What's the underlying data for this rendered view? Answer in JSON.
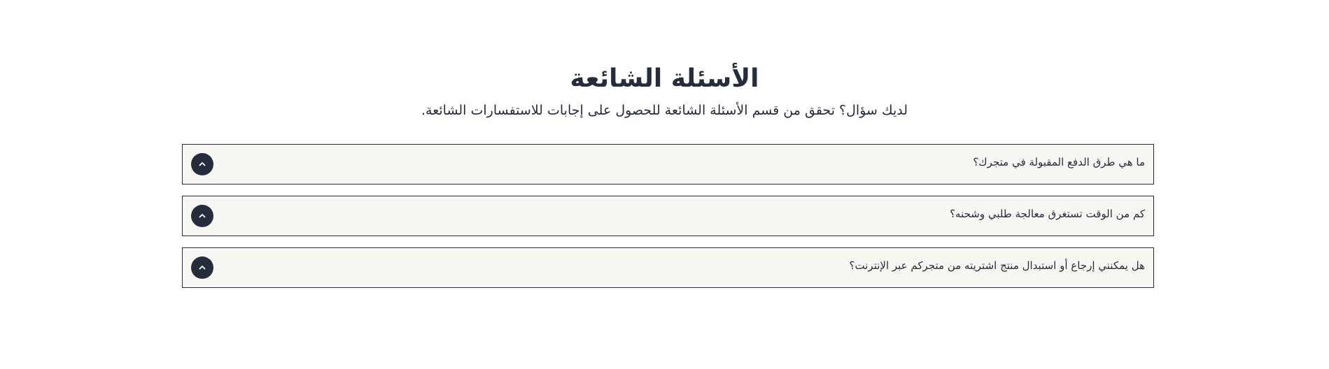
{
  "faq": {
    "title": "الأسئلة الشائعة",
    "subtitle": "لديك سؤال؟ تحقق من قسم الأسئلة الشائعة للحصول على إجابات للاستفسارات الشائعة.",
    "items": [
      {
        "question": "ما هي طرق الدفع المقبولة في متجرك؟",
        "toggle_icon": "chevron-up-icon"
      },
      {
        "question": "كم من الوقت تستغرق معالجة طلبي وشحنه؟",
        "toggle_icon": "chevron-up-icon"
      },
      {
        "question": "هل يمكنني إرجاع أو استبدال منتج اشتريته من متجركم عبر الإنترنت؟",
        "toggle_icon": "chevron-up-icon"
      }
    ]
  },
  "colors": {
    "text": "#252d3d",
    "item_background": "#f7f6f3",
    "item_border": "#252d3d",
    "toggle_background": "#252d3d",
    "toggle_icon": "#ffffff"
  }
}
